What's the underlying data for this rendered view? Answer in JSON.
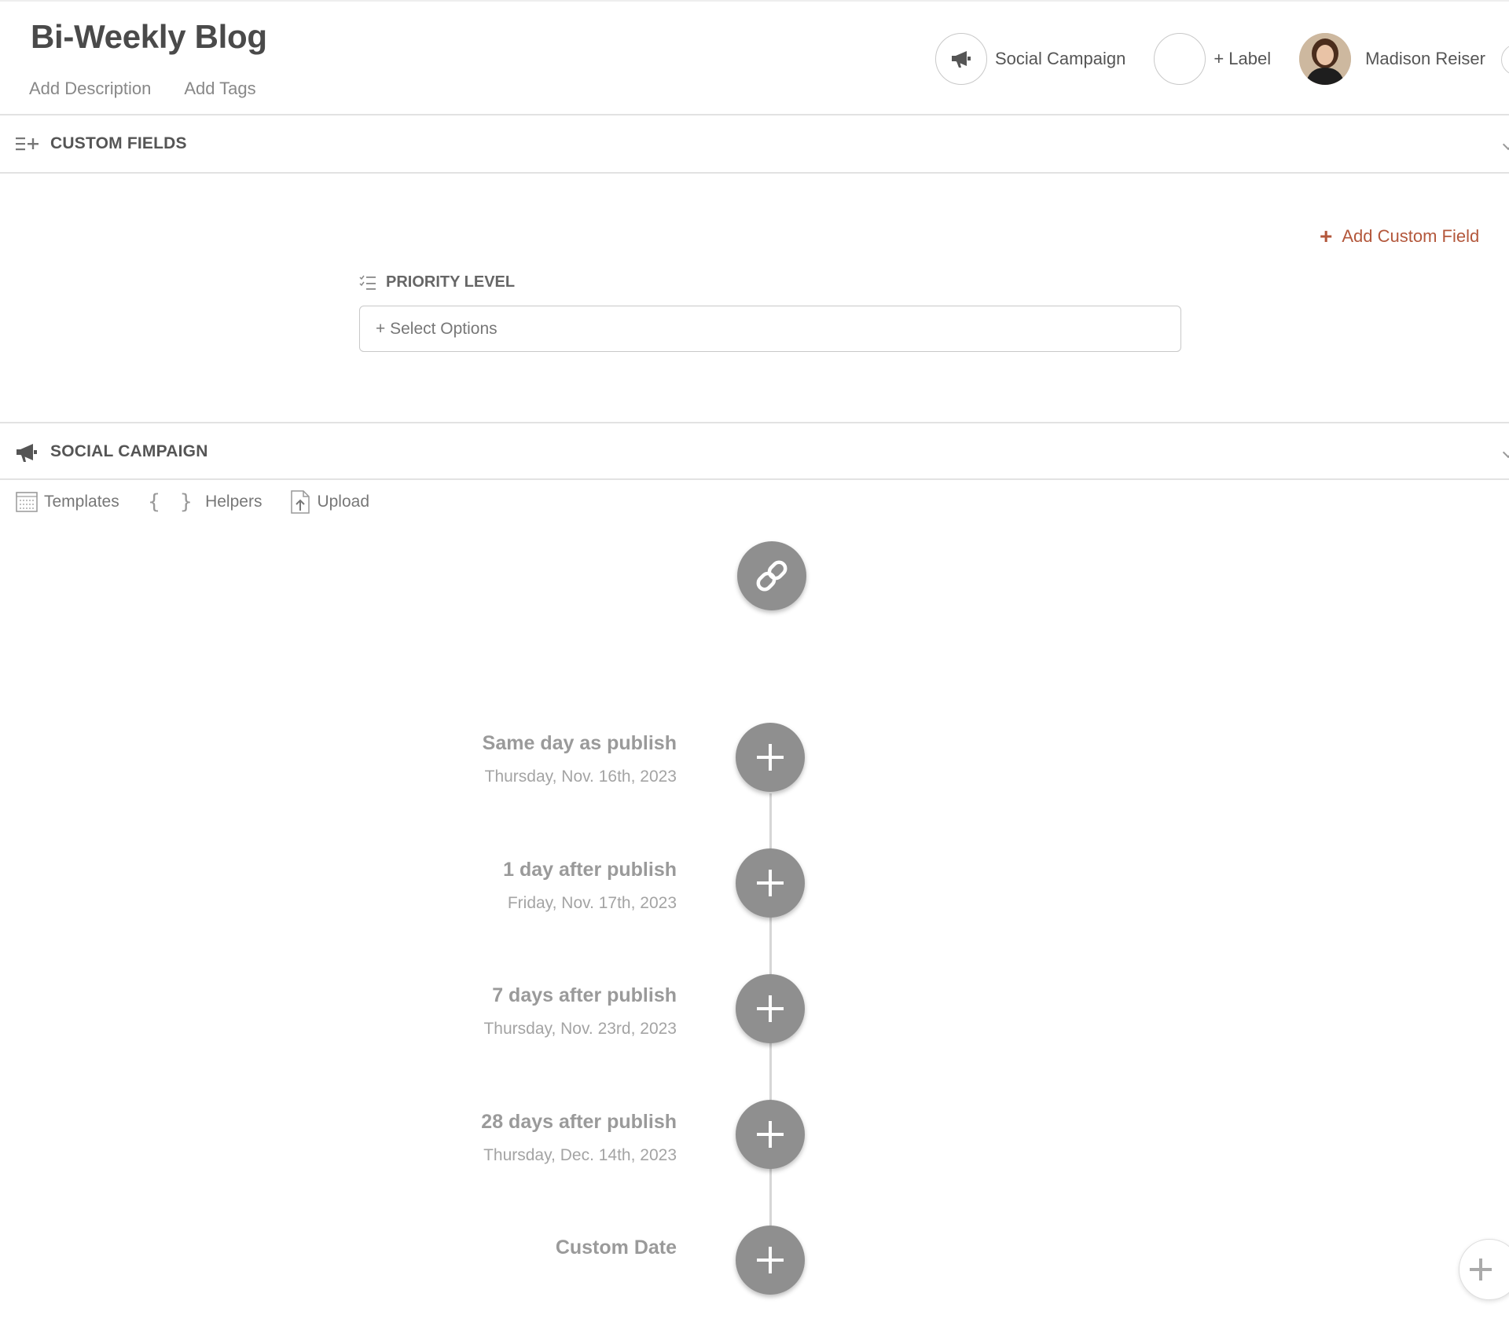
{
  "header": {
    "title": "Bi-Weekly Blog",
    "add_description": "Add Description",
    "add_tags": "Add Tags",
    "campaign_label": "Social Campaign",
    "label_button": "+ Label",
    "user_name": "Madison Reiser"
  },
  "custom_fields": {
    "section_title": "CUSTOM FIELDS",
    "add_field": "Add Custom Field",
    "field_label": "PRIORITY LEVEL",
    "select_placeholder": "+ Select Options"
  },
  "social_campaign": {
    "section_title": "SOCIAL CAMPAIGN",
    "toolbar": {
      "templates": "Templates",
      "helpers": "Helpers",
      "upload": "Upload"
    },
    "timeline": [
      {
        "title": "Same day as publish",
        "date": "Thursday, Nov. 16th, 2023"
      },
      {
        "title": "1 day after publish",
        "date": "Friday, Nov. 17th, 2023"
      },
      {
        "title": "7 days after publish",
        "date": "Thursday, Nov. 23rd, 2023"
      },
      {
        "title": "28 days after publish",
        "date": "Thursday, Dec. 14th, 2023"
      },
      {
        "title": "Custom Date",
        "date": ""
      }
    ]
  },
  "colors": {
    "accent": "#b3573b",
    "button_gray": "#8f8f8f",
    "text_dark": "#4a4a4a"
  },
  "icons": {
    "campaign": "megaphone-icon",
    "custom_fields": "list-plus-icon",
    "priority": "checklist-icon",
    "templates": "template-grid-icon",
    "helpers": "braces-icon",
    "upload": "upload-file-icon",
    "link": "link-icon",
    "add": "plus-icon"
  }
}
